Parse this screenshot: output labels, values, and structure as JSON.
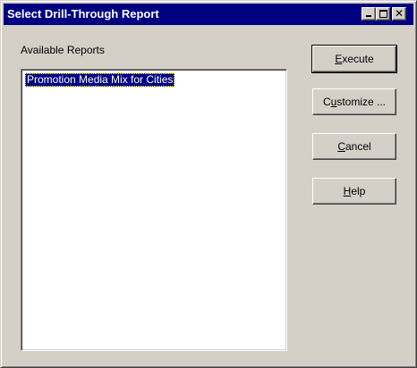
{
  "window": {
    "title": "Select Drill-Through Report",
    "controls": [
      "minimize-icon",
      "maximize-icon",
      "close-icon"
    ]
  },
  "reports": {
    "label": "Available Reports",
    "items": [
      {
        "label": "Promotion Media Mix for Cities",
        "selected": true
      }
    ]
  },
  "buttons": {
    "execute": {
      "accel": "E",
      "rest": "xecute"
    },
    "customize": {
      "pre": "C",
      "accel": "u",
      "rest": "stomize ..."
    },
    "cancel": {
      "accel": "C",
      "rest": "ancel"
    },
    "help": {
      "accel": "H",
      "rest": "elp"
    }
  },
  "colors": {
    "titlebar": "#000080",
    "face": "#d4d0c8",
    "selection": "#000080"
  }
}
